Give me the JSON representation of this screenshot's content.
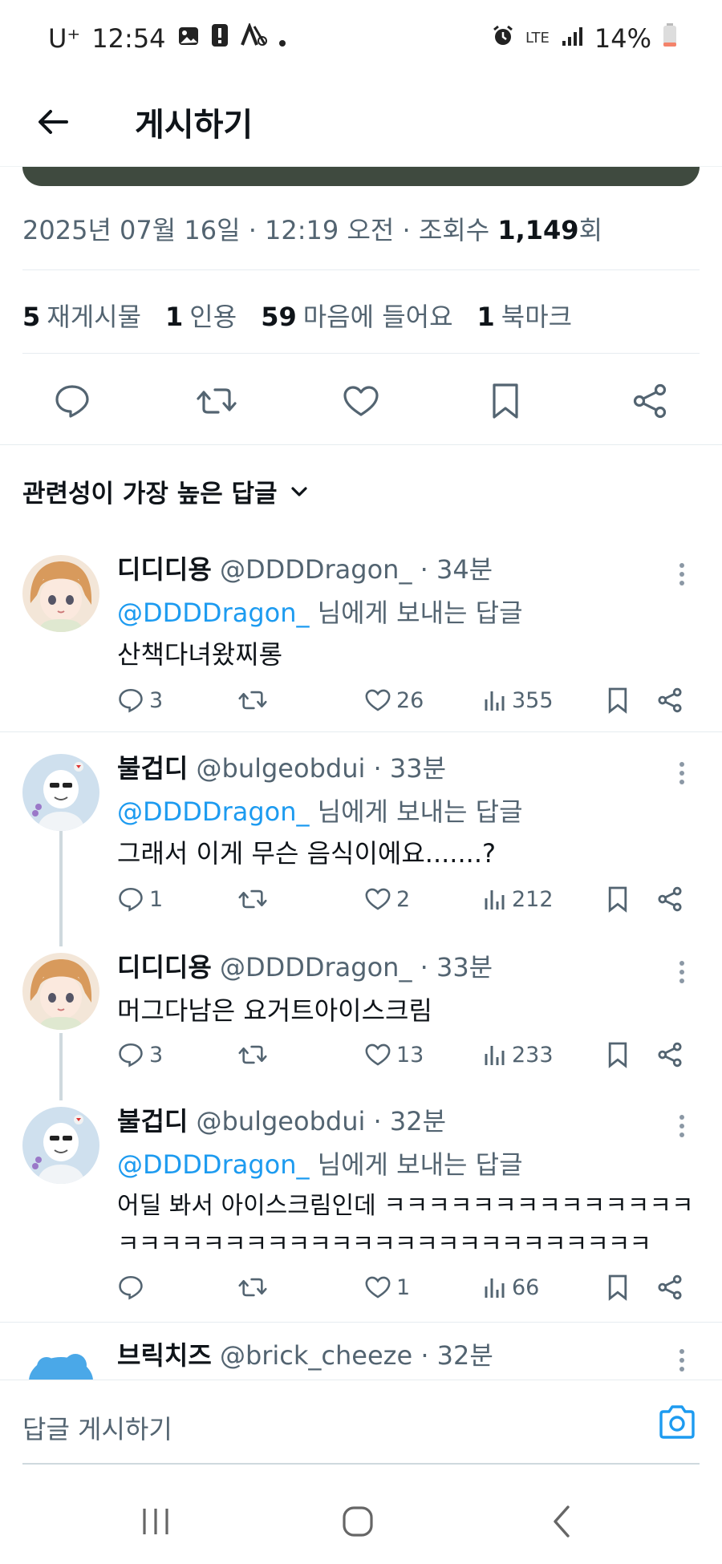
{
  "status_bar": {
    "carrier": "U⁺",
    "time": "12:54",
    "network": "LTE",
    "battery": "14%"
  },
  "header": {
    "title": "게시하기"
  },
  "post": {
    "meta_date": "2025년 07월 16일 · 12:19 오전 · 조회수 ",
    "meta_views": "1,149",
    "meta_suffix": "회",
    "stats": [
      {
        "num": "5",
        "label": "재게시물"
      },
      {
        "num": "1",
        "label": "인용"
      },
      {
        "num": "59",
        "label": "마음에 들어요"
      },
      {
        "num": "1",
        "label": "북마크"
      }
    ]
  },
  "sort_label": "관련성이 가장 높은 답글",
  "replies": [
    {
      "name": "디디디용",
      "handle": "@DDDDragon_",
      "time": " · 34분",
      "mention": "@DDDDragon_",
      "mention_suffix": " 님에게 보내는 답글",
      "text": "산책다녀왔찌롱",
      "comments": "3",
      "likes": "26",
      "views": "355"
    },
    {
      "name": "불겁디",
      "handle": "@bulgeobdui",
      "time": " · 33분",
      "mention": "@DDDDragon_",
      "mention_suffix": " 님에게 보내는 답글",
      "text": "그래서 이게 무슨 음식이에요.......?",
      "comments": "1",
      "likes": "2",
      "views": "212"
    },
    {
      "name": "디디디용",
      "handle": "@DDDDragon_",
      "time": " · 33분",
      "text": "머그다남은 요거트아이스크림",
      "comments": "3",
      "likes": "13",
      "views": "233"
    },
    {
      "name": "불겁디",
      "handle": "@bulgeobdui",
      "time": " · 32분",
      "mention": "@DDDDragon_",
      "mention_suffix": " 님에게 보내는 답글",
      "text": "어딜 봐서 아이스크림인데 ㅋㅋㅋㅋㅋㅋㅋㅋㅋㅋㅋㅋㅋㅋ",
      "text2": "ㅋㅋㅋㅋㅋㅋㅋㅋㅋㅋㅋㅋㅋㅋㅋㅋㅋㅋㅋㅋㅋㅋㅋㅋㅋ",
      "comments": "",
      "likes": "1",
      "views": "66"
    },
    {
      "name": "브릭치즈",
      "handle": "@brick_cheeze",
      "time": " · 32분"
    }
  ],
  "composer": {
    "placeholder": "답글 게시하기"
  },
  "colors": {
    "accent": "#1d9bf0",
    "text": "#0f1419",
    "secondary": "#536471"
  }
}
